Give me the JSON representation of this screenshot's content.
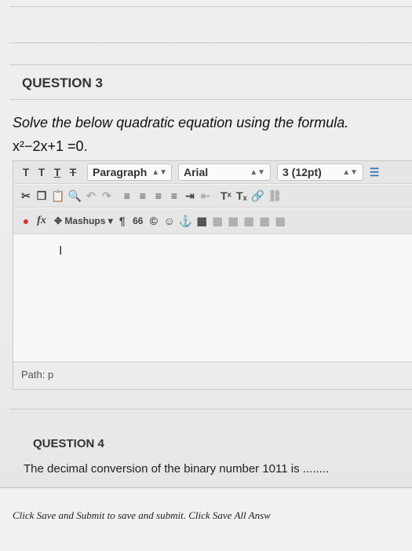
{
  "question3": {
    "title": "QUESTION 3",
    "prompt": "Solve the below quadratic equation using the formula.",
    "equation": "x²−2x+1 =0."
  },
  "toolbar": {
    "row1": {
      "format_icons": [
        "T",
        "T",
        "T",
        "T"
      ],
      "paragraph": "Paragraph",
      "font": "Arial",
      "size": "3 (12pt)"
    },
    "row2": {
      "superscript": "Tˣ",
      "subscript": "Tₓ"
    },
    "row3": {
      "mashups": "Mashups",
      "pilcrow": "¶",
      "quote": "66"
    }
  },
  "editor": {
    "path_label": "Path: p"
  },
  "question4": {
    "title": "QUESTION 4",
    "prompt": "The decimal conversion of the binary number 1011 is ........"
  },
  "footer": {
    "text": "Click Save and Submit to save and submit. Click Save All Answ"
  }
}
